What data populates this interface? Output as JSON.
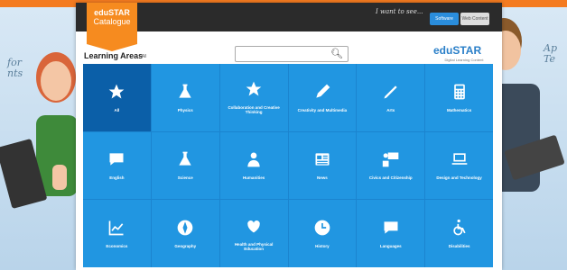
{
  "page": {
    "left_note": "for\nnts",
    "right_note": "Ap\nTe"
  },
  "header": {
    "logo_line1": "eduSTAR",
    "logo_line2": "Catalogue",
    "i_want_text": "I want to see...",
    "toggle_left": "Software",
    "toggle_right": "Web Content"
  },
  "toolbar": {
    "section_title": "Learning Areas",
    "section_all": "- All",
    "search_placeholder": "",
    "brand": "eduSTAR",
    "brand_sub": "Digital Learning Content"
  },
  "tiles": [
    {
      "label": "All",
      "icon": "star-icon"
    },
    {
      "label": "Physics",
      "icon": "flask-icon"
    },
    {
      "label": "Collaboration and Creative Thinking",
      "icon": "star-icon"
    },
    {
      "label": "Creativity and Multimedia",
      "icon": "pencil-icon"
    },
    {
      "label": "Arts",
      "icon": "brush-icon"
    },
    {
      "label": "Mathematics",
      "icon": "calculator-icon"
    },
    {
      "label": "English",
      "icon": "speech-bubble-icon"
    },
    {
      "label": "Science",
      "icon": "flask-icon"
    },
    {
      "label": "Humanities",
      "icon": "person-icon"
    },
    {
      "label": "News",
      "icon": "newspaper-icon"
    },
    {
      "label": "Civics and Citizenship",
      "icon": "teacher-icon"
    },
    {
      "label": "Design and Technology",
      "icon": "laptop-icon"
    },
    {
      "label": "Economics",
      "icon": "chart-icon"
    },
    {
      "label": "Geography",
      "icon": "compass-icon"
    },
    {
      "label": "Health and Physical Education",
      "icon": "heart-icon"
    },
    {
      "label": "History",
      "icon": "clock-icon"
    },
    {
      "label": "Languages",
      "icon": "speech-bubble-icon"
    },
    {
      "label": "Disabilities",
      "icon": "wheelchair-icon"
    }
  ],
  "colors": {
    "tile": "#2196e1",
    "tile_selected": "#0b5fa8",
    "accent": "#f68b1f"
  }
}
